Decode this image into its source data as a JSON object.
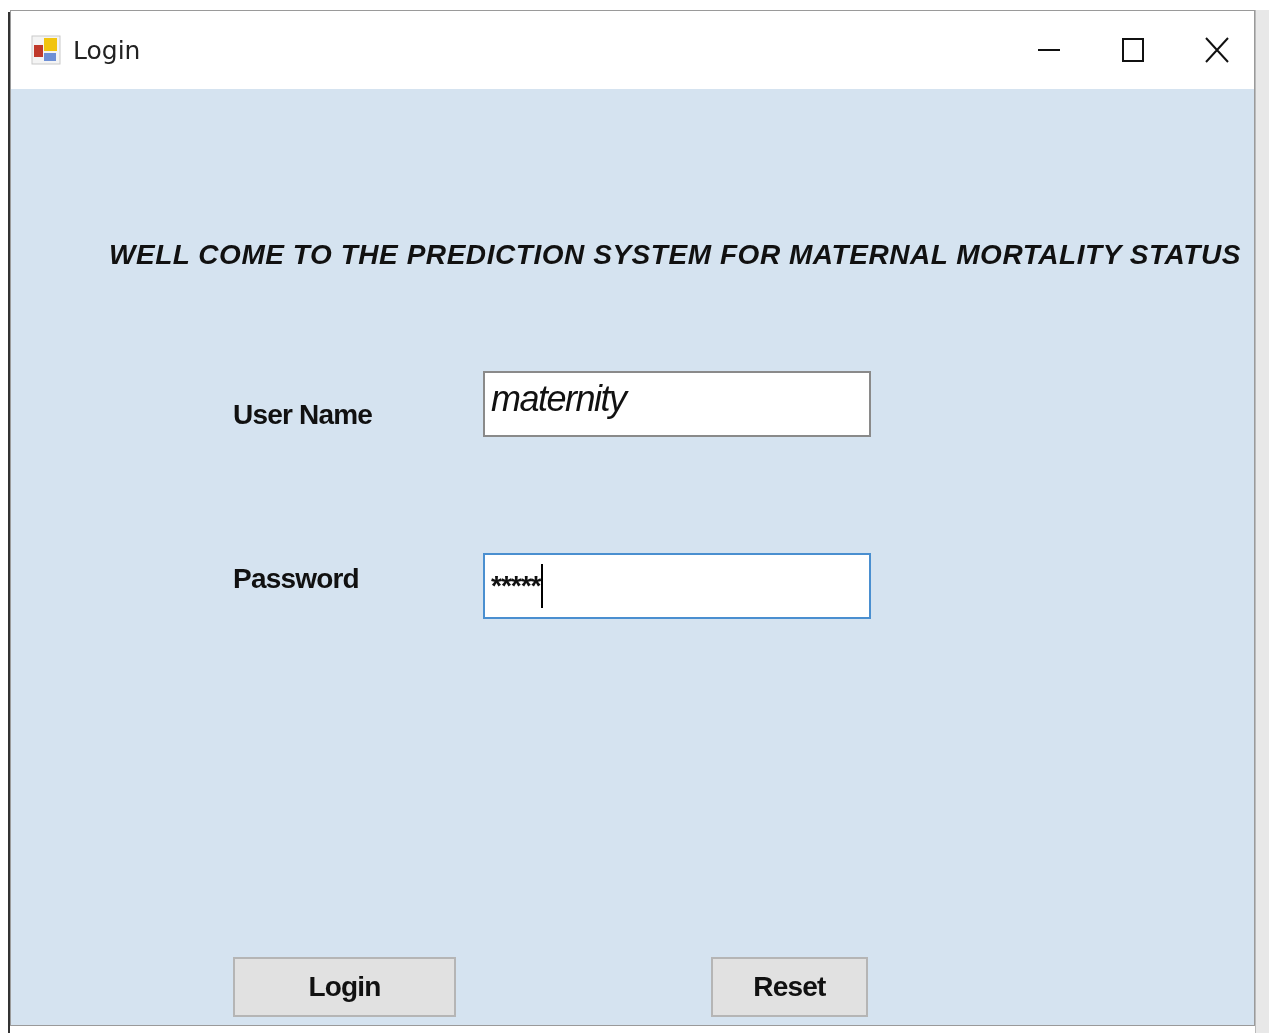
{
  "window": {
    "title": "Login"
  },
  "heading": "WELL COME TO THE PREDICTION SYSTEM FOR MATERNAL MORTALITY STATUS",
  "fields": [
    {
      "label": "User Name",
      "value": "maternity",
      "kind": "text",
      "focused": false
    },
    {
      "label": "Password",
      "value": "*****",
      "kind": "password",
      "focused": true
    }
  ],
  "buttons": [
    "Login",
    "Reset"
  ]
}
